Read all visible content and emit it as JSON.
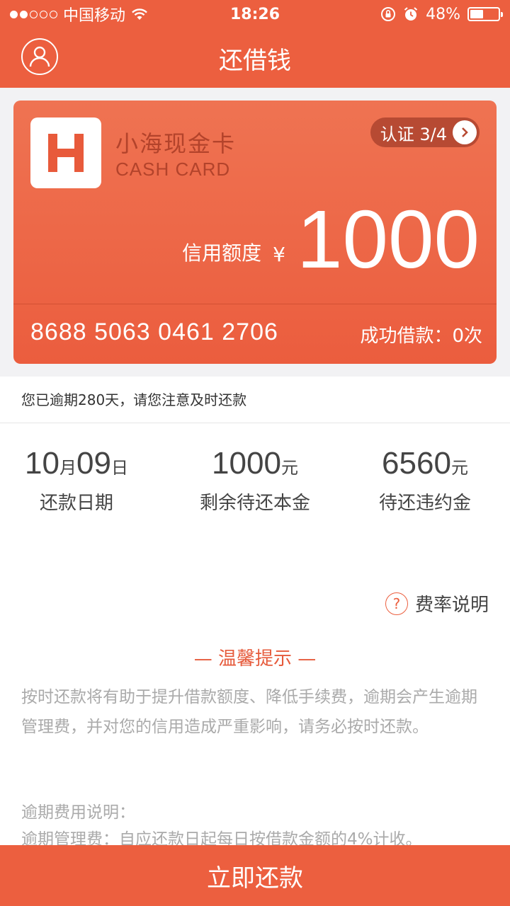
{
  "status_bar": {
    "carrier": "中国移动",
    "time": "18:26",
    "battery": "48%",
    "battery_level": 0.48
  },
  "nav": {
    "title": "还借钱"
  },
  "card": {
    "logo_letter": "H",
    "name": "小海现金卡",
    "subtitle": "CASH CARD",
    "cert": "认证 3/4",
    "credit_label": "信用额度",
    "currency": "¥",
    "credit_amount": "1000",
    "number": "8688 5063 0461 2706",
    "success_count": "成功借款：0次"
  },
  "notice": "您已逾期280天，请您注意及时还款",
  "stats": {
    "due_date": {
      "month": "10",
      "month_unit": "月",
      "day": "09",
      "day_unit": "日",
      "label": "还款日期"
    },
    "principal": {
      "value": "1000",
      "unit": "元",
      "label": "剩余待还本金"
    },
    "penalty": {
      "value": "6560",
      "unit": "元",
      "label": "待还违约金"
    }
  },
  "rate_link": "费率说明",
  "tips": {
    "title": "— 温馨提示 —",
    "body": "按时还款将有助于提升借款额度、降低手续费，逾期会产生逾期管理费，并对您的信用造成严重影响，请务必按时还款。",
    "fee_title": "逾期费用说明：",
    "fee_line": "逾期管理费：自应还款日起每日按借款金额的4%计收。"
  },
  "action": {
    "repay_label": "立即还款"
  },
  "colors": {
    "brand": "#ec5f3f",
    "card_dark_text": "#b3432b"
  }
}
